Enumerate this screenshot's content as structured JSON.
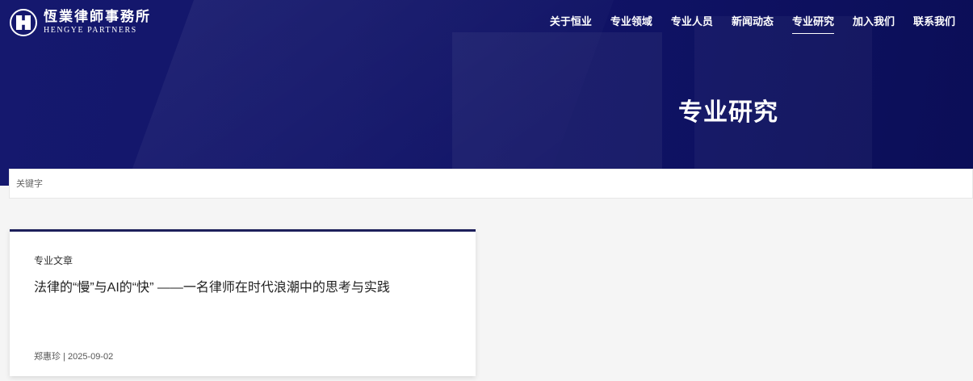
{
  "header": {
    "logo_cn": "恆業律師事務所",
    "logo_en": "HENGYE PARTNERS",
    "nav": [
      {
        "label": "关于恒业"
      },
      {
        "label": "专业领域"
      },
      {
        "label": "专业人员"
      },
      {
        "label": "新闻动态"
      },
      {
        "label": "专业研究",
        "active": true
      },
      {
        "label": "加入我们"
      },
      {
        "label": "联系我们"
      }
    ]
  },
  "hero": {
    "title": "专业研究"
  },
  "search": {
    "placeholder": "关键字"
  },
  "articles": [
    {
      "category": "专业文章",
      "title": "法律的“慢”与AI的“快” ——一名律师在时代浪潮中的思考与实践",
      "meta": "郑惠珍 | 2025-09-02"
    }
  ],
  "colors": {
    "hero_bg": "#13166a",
    "card_accent": "#1d1f5b",
    "page_bg": "#f5f5f5"
  }
}
